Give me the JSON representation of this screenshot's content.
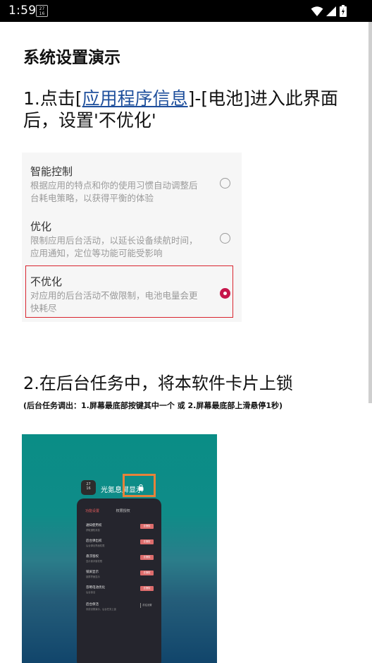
{
  "status_bar": {
    "time": "1:59",
    "app_icon_text": "27\n16"
  },
  "page": {
    "title": "系统设置演示",
    "step1": {
      "prefix": "1.点击[",
      "link": "应用程序信息",
      "suffix": "]-[电池]进入此界面后，设置'不优化'"
    },
    "step2": {
      "text": "2.在后台任务中，将本软件卡片上锁",
      "note": "(后台任务调出：1.屏幕最底部按键其中一个 或 2.屏幕最底部上滑悬停1秒)"
    }
  },
  "settings_card": {
    "options": [
      {
        "title": "智能控制",
        "desc": "根据应用的特点和你的使用习惯自动调整后台耗电策略，以获得平衡的体验",
        "selected": false
      },
      {
        "title": "优化",
        "desc": "限制应用后台活动，以延长设备续航时间，应用通知，定位等功能可能受影响",
        "selected": false
      },
      {
        "title": "不优化",
        "desc": "对应用的后台活动不做限制，电池电量会更快耗尽",
        "selected": true
      }
    ],
    "highlight_color": "#d9252f",
    "radio_selected_color": "#c6164b"
  },
  "recents_card": {
    "app_icon_text": "27\n16",
    "app_name": "光氪息屏显示",
    "highlight_color": "#e7823a",
    "tabs": {
      "active": "功能设置",
      "inactive": "权限授权"
    },
    "rows": [
      {
        "title": "通知使用权",
        "sub": "获取通知消息",
        "button": "去授权"
      },
      {
        "title": "后台弹出权",
        "sub": "后台弹出界面权限",
        "button": "去授权"
      },
      {
        "title": "悬浮窗权",
        "sub": "显示悬浮窗权限",
        "button": "去授权"
      },
      {
        "title": "锁屏显示",
        "sub": "锁屏界面显示",
        "button": "去授权"
      },
      {
        "title": "忽略电池优化",
        "sub": "后台保活",
        "button": "去授权"
      },
      {
        "title": "后台保活",
        "sub": "系统设置演示，后台任务上锁",
        "button": "前往设置"
      }
    ]
  }
}
